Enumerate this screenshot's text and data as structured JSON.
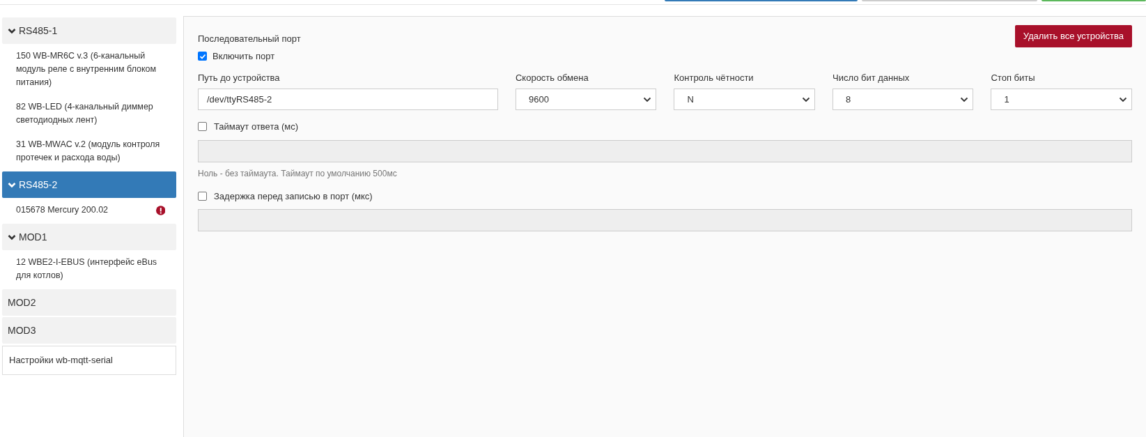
{
  "top_buttons": [
    {
      "color": "#337ab7"
    },
    {
      "color": "#cccccc"
    },
    {
      "color": "#5cb85c"
    }
  ],
  "sidebar": {
    "groups": [
      {
        "label": "RS485-1",
        "kind": "port",
        "expanded": true,
        "selected": false,
        "devices": [
          {
            "label": "150 WB-MR6C v.3 (6-канальный модуль реле с внутренним блоком питания)",
            "error": false
          },
          {
            "label": "82 WB-LED (4-канальный диммер светодиодных лент)",
            "error": false
          },
          {
            "label": "31 WB-MWAC v.2 (модуль контроля протечек и расхода воды)",
            "error": false
          }
        ]
      },
      {
        "label": "RS485-2",
        "kind": "port",
        "expanded": true,
        "selected": true,
        "devices": [
          {
            "label": "015678 Mercury 200.02",
            "error": true
          }
        ]
      },
      {
        "label": "MOD1",
        "kind": "port",
        "expanded": true,
        "selected": false,
        "devices": [
          {
            "label": "12 WBE2-I-EBUS (интерфейс eBus для котлов)",
            "error": false
          }
        ]
      },
      {
        "label": "MOD2",
        "kind": "port",
        "expanded": false,
        "selected": false
      },
      {
        "label": "MOD3",
        "kind": "port",
        "expanded": false,
        "selected": false
      },
      {
        "label": "Настройки wb-mqtt-serial",
        "kind": "settings",
        "selected": false
      }
    ]
  },
  "panel": {
    "title": "Последовательный порт",
    "delete_button": "Удалить все устройства",
    "enable_port": {
      "label": "Включить порт",
      "checked": true
    },
    "fields": [
      {
        "label": "Путь до устройства",
        "kind": "text",
        "value": "/dev/ttyRS485-2"
      },
      {
        "label": "Скорость обмена",
        "kind": "select",
        "value": "9600"
      },
      {
        "label": "Контроль чётности",
        "kind": "select",
        "value": "N"
      },
      {
        "label": "Число бит данных",
        "kind": "select",
        "value": "8"
      },
      {
        "label": "Стоп биты",
        "kind": "select",
        "value": "1"
      }
    ],
    "options": [
      {
        "label": "Таймаут ответа (мс)",
        "checked": false,
        "hint": "Ноль - без таймаута. Таймаут по умолчанию 500мс"
      },
      {
        "label": "Задержка перед записью в порт (мкс)",
        "checked": false
      }
    ]
  }
}
